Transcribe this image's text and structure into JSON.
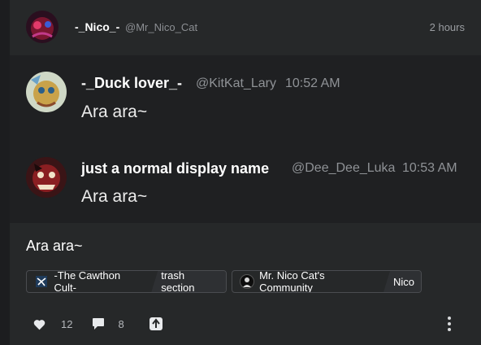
{
  "post": {
    "author_name": "-_Nico_-",
    "author_handle": "@Mr_Nico_Cat",
    "time": "2 hours",
    "text": "Ara ara~"
  },
  "quoted": [
    {
      "name": "-_Duck lover_-",
      "handle": "@KitKat_Lary",
      "time": "10:52 AM",
      "text": "Ara ara~"
    },
    {
      "name": "just a normal display name",
      "handle": "@Dee_Dee_Luka",
      "time": "10:53 AM",
      "text": "Ara ara~"
    }
  ],
  "tags": [
    {
      "community": "-The Cawthon Cult-",
      "section": "trash section"
    },
    {
      "community": "Mr. Nico Cat's Community",
      "section": "Nico"
    }
  ],
  "actions": {
    "likes": "12",
    "comments": "8"
  },
  "icons": [
    "heart-icon",
    "comment-icon",
    "share-icon",
    "more-vertical-icon"
  ]
}
